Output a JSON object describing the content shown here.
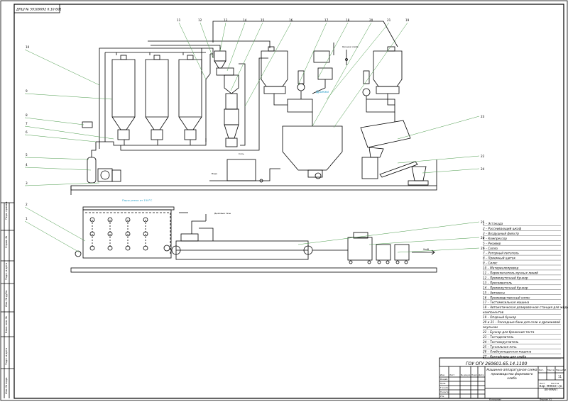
{
  "sheet": {
    "stamp_code": "ДПШ № 59109092 6.10 601",
    "doc_code": "ГОУ ОГУ 260601.65.14.1100",
    "drawing_title": "Машинно-аппаратурная схема производства формового хлеба",
    "group": "Кар. МАКОП гр. 06-МАКП",
    "sheet_count": "11",
    "scale_header": "Масштаб",
    "mass_header": "Масса",
    "lit_header": "Лит.",
    "sheet_label": "Лист",
    "sheets_label": "Листов",
    "format_label": "Формат  А1",
    "copied_label": "Копировал",
    "side_labels": [
      "Перв. примен.",
      "Справ. №",
      "Подп. и дата",
      "Инв. № дубл.",
      "Взам. инв. №",
      "Подп. и дата",
      "Инв. № подл."
    ]
  },
  "callouts": {
    "top": [
      "11",
      "12",
      "13",
      "14",
      "15",
      "16",
      "17",
      "18",
      "20",
      "21",
      "19"
    ],
    "left_upper": [
      "10",
      "9",
      "8",
      "7",
      "6",
      "5",
      "4",
      "3"
    ],
    "left_lower": [
      "2",
      "1"
    ],
    "right": [
      "23",
      "22",
      "24"
    ],
    "right_lower": [
      "25",
      "26",
      "27"
    ]
  },
  "annotations": {
    "drozhzhi": "Дрожжи",
    "kroshka": "Крошка хлеба",
    "sol": "Соль",
    "voda": "Вода",
    "par": "Пары упека  от 150°С",
    "dyma": "Дымовые газы",
    "hleb": "Хлеб"
  },
  "legend": [
    "1 – Эстакада",
    "2 – Рассеивающий шкаф",
    "3 – Воздушный фильтр",
    "4 – Компрессор",
    "5 – Ресивер",
    "6 – Сопло",
    "7 – Роторный питатель",
    "8 – Приемный щиток",
    "9 – Силос",
    "10 – Материалопровод",
    "11 – Переключатель мучных линий",
    "12 – Промежуточный бункер",
    "13 – Просеиватель",
    "14 – Промежуточный бункер",
    "15 – Автовесы",
    "16 – Производственный силос",
    "17 – Тестомесильная машина",
    "18 – Автоматическая дозировочная станция для жидких компонентов",
    "19 – Опарный бункер",
    "20 и 21 – Расходные баки для соли и дрожжевой эмульсии",
    "22 – Бункер для брожения теста",
    "23 – Тестоделитель",
    "24 – Тестоокруглитель",
    "25 – Туннельная печь",
    "26 – Хлебоукладочная машина",
    "27 – Контейнеры для хлеба"
  ],
  "title_block_rows": [
    "Изм.",
    "Лист",
    "№ докум.",
    "Подп.",
    "Дата",
    "Разраб.",
    "Пров.",
    "Т.контр.",
    "Н.контр.",
    "Утв."
  ]
}
